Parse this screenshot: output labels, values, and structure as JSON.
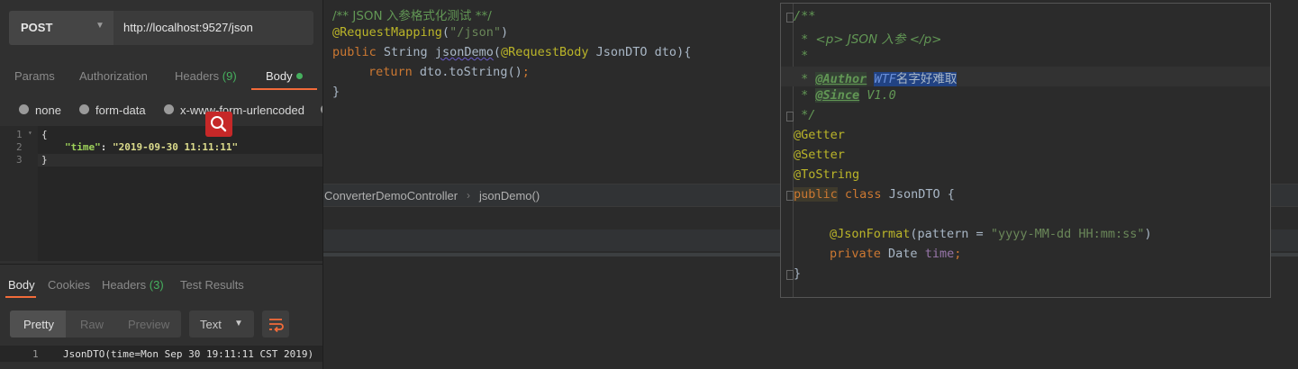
{
  "postman": {
    "method": "POST",
    "url": "http://localhost:9527/json",
    "request_tabs": [
      {
        "label": "Params"
      },
      {
        "label": "Authorization"
      },
      {
        "label": "Headers",
        "count": "(9)"
      },
      {
        "label": "Body"
      }
    ],
    "body_types": [
      "none",
      "form-data",
      "x-www-form-urlencoded"
    ],
    "request_body": {
      "line_numbers": [
        "1",
        "2",
        "3"
      ],
      "open_brace": "{",
      "key": "\"time\"",
      "colon": ": ",
      "value": "\"2019-09-30 11:11:11\"",
      "close_brace": "}"
    },
    "response_tabs": [
      {
        "label": "Body"
      },
      {
        "label": "Cookies"
      },
      {
        "label": "Headers",
        "count": "(3)"
      },
      {
        "label": "Test Results"
      }
    ],
    "view_modes": [
      "Pretty",
      "Raw",
      "Preview"
    ],
    "format": "Text",
    "response_line_number": "1",
    "response_text": "JsonDTO(time=Mon Sep 30 19:11:11 CST 2019)"
  },
  "ide": {
    "comment": "/** JSON 入参格式化测试 **/",
    "mapping_anno": "@RequestMapping",
    "mapping_open": "(",
    "mapping_path": "\"/json\"",
    "mapping_close": ")",
    "public_kw": "public",
    "return_type": " String ",
    "method_name": "jsonDemo",
    "param_open": "(",
    "param_anno": "@RequestBody",
    "param_rest": " JsonDTO dto){",
    "return_kw": "return",
    "return_expr": " dto.toString()",
    "semicolon": ";",
    "close_brace": "}",
    "breadcrumb_class": "ConverterDemoController",
    "breadcrumb_method": "jsonDemo()"
  },
  "popup": {
    "doc_open": "/**",
    "doc_p_prefix": " * ",
    "doc_p": "<p> JSON 入参 </p>",
    "doc_star": " *",
    "doc_author_tag": "@Author",
    "doc_author_val": "WTF",
    "doc_author_cn": "名字好难取",
    "doc_since_tag": "@Since",
    "doc_since_val": " V1.0",
    "doc_close": " */",
    "anno_getter": "@Getter",
    "anno_setter": "@Setter",
    "anno_tostring": "@ToString",
    "public_kw": "public",
    "class_kw": "class",
    "class_name": " JsonDTO {",
    "json_format_anno": "@JsonFormat",
    "json_format_open": "(pattern = ",
    "json_format_pattern": "\"yyyy-MM-dd HH:mm:ss\"",
    "json_format_close": ")",
    "private_kw": "private",
    "field_type": " Date ",
    "field_name": "time",
    "field_semicolon": ";",
    "class_close": "}"
  },
  "colors": {
    "postman_accent": "#f26b3a",
    "postman_count": "#46b05e",
    "ide_keyword": "#cc7832",
    "ide_annotation": "#bbb529",
    "ide_string": "#6a8759",
    "ide_comment": "#629755",
    "ide_field": "#9876aa"
  }
}
